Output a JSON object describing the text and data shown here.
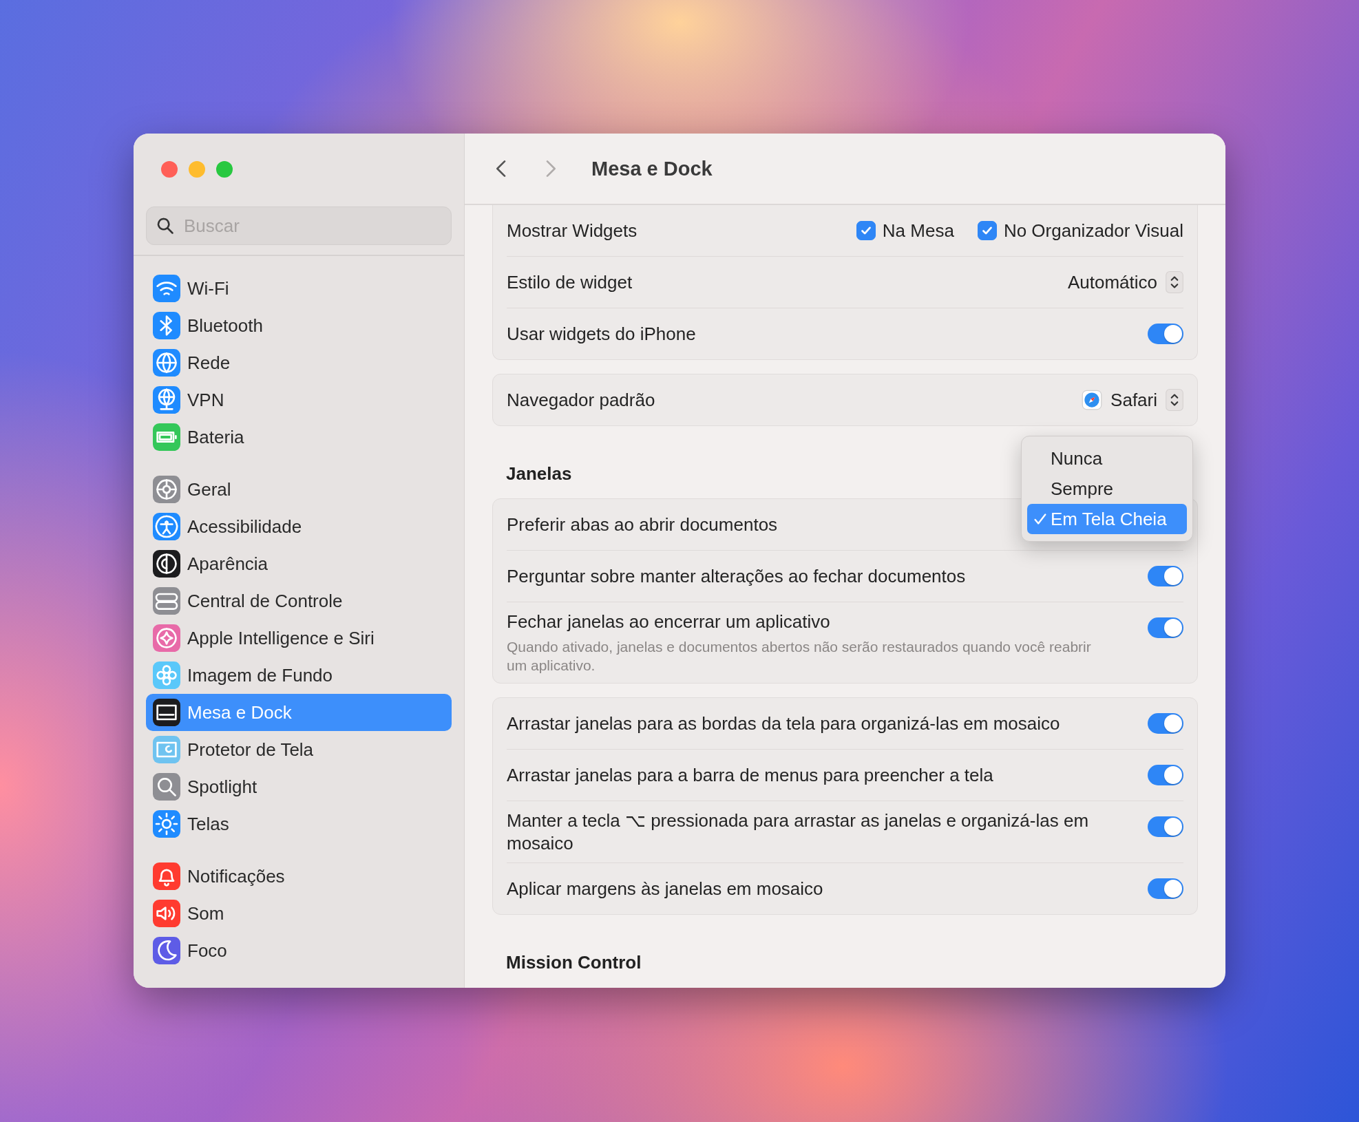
{
  "window": {
    "title": "Mesa e Dock",
    "nav": {
      "back": {
        "disabled": false
      },
      "forward": {
        "disabled": true
      }
    }
  },
  "sidebar": {
    "search": {
      "placeholder": "Buscar"
    },
    "groups": [
      {
        "items": [
          {
            "label": "Wi-Fi",
            "kind": "wifi",
            "selected": false
          },
          {
            "label": "Bluetooth",
            "kind": "bluetooth",
            "selected": false
          },
          {
            "label": "Rede",
            "kind": "globe",
            "selected": false
          },
          {
            "label": "VPN",
            "kind": "vpn",
            "selected": false
          },
          {
            "label": "Bateria",
            "kind": "battery",
            "selected": false
          }
        ]
      },
      {
        "items": [
          {
            "label": "Geral",
            "kind": "gear",
            "selected": false
          },
          {
            "label": "Acessibilidade",
            "kind": "accessibility",
            "selected": false
          },
          {
            "label": "Aparência",
            "kind": "appearance",
            "selected": false
          },
          {
            "label": "Central de Controle",
            "kind": "controls",
            "selected": false
          },
          {
            "label": "Apple Intelligence e Siri",
            "kind": "siri",
            "selected": false
          },
          {
            "label": "Imagem de Fundo",
            "kind": "flower",
            "selected": false
          },
          {
            "label": "Mesa e Dock",
            "kind": "dock",
            "selected": true
          },
          {
            "label": "Protetor de Tela",
            "kind": "screensaver",
            "selected": false
          },
          {
            "label": "Spotlight",
            "kind": "search",
            "selected": false
          },
          {
            "label": "Telas",
            "kind": "sun",
            "selected": false
          }
        ]
      },
      {
        "items": [
          {
            "label": "Notificações",
            "kind": "bell",
            "selected": false
          },
          {
            "label": "Som",
            "kind": "speaker",
            "selected": false
          },
          {
            "label": "Foco",
            "kind": "moon",
            "selected": false
          }
        ]
      }
    ]
  },
  "sections": [
    {
      "cards": [
        {
          "rows": [
            {
              "kind": "checkboxes",
              "label": "Mostrar Widgets",
              "options": [
                {
                  "label": "Na Mesa",
                  "checked": true
                },
                {
                  "label": "No Organizador Visual",
                  "checked": true
                }
              ]
            },
            {
              "kind": "popup",
              "label": "Estilo de widget",
              "value": "Automático"
            },
            {
              "kind": "toggle",
              "label": "Usar widgets do iPhone",
              "on": true
            }
          ]
        },
        {
          "rows": [
            {
              "kind": "popup",
              "label": "Navegador padrão",
              "value": "Safari",
              "app_icon": true
            }
          ]
        }
      ]
    },
    {
      "heading": "Janelas",
      "cards": [
        {
          "rows": [
            {
              "kind": "menu",
              "label": "Preferir abas ao abrir documentos",
              "options": [
                {
                  "label": "Nunca",
                  "selected": false
                },
                {
                  "label": "Sempre",
                  "selected": false
                },
                {
                  "label": "Em Tela Cheia",
                  "selected": true
                }
              ]
            },
            {
              "kind": "toggle",
              "label": "Perguntar sobre manter alterações ao fechar documentos",
              "on": true
            },
            {
              "kind": "toggle",
              "label": "Fechar janelas ao encerrar um aplicativo",
              "on": true,
              "description": "Quando ativado, janelas e documentos abertos não serão restaurados quando você reabrir um aplicativo."
            }
          ]
        },
        {
          "rows": [
            {
              "kind": "toggle",
              "label": "Arrastar janelas para as bordas da tela para organizá-las em mosaico",
              "on": true
            },
            {
              "kind": "toggle",
              "label": "Arrastar janelas para a barra de menus para preencher a tela",
              "on": true
            },
            {
              "kind": "toggle",
              "label": "Manter a tecla ⌥ pressionada para arrastar as janelas e organizá-las em mosaico",
              "on": true
            },
            {
              "kind": "toggle",
              "label": "Aplicar margens às janelas em mosaico",
              "on": true
            }
          ]
        }
      ]
    },
    {
      "heading": "Mission Control"
    }
  ]
}
